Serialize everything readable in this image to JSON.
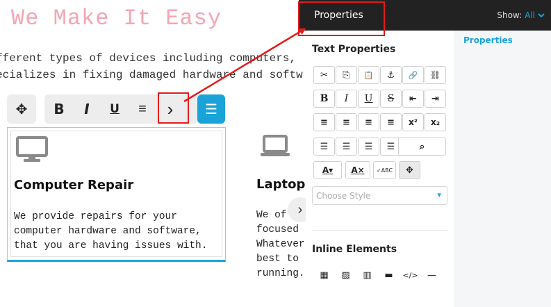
{
  "canvas": {
    "hero_title": "We Make It Easy",
    "intro_lines": [
      "fferent types of devices including computers,",
      "ecializes in fixing damaged hardware and softw"
    ],
    "card1": {
      "title": "Computer Repair",
      "text_lines": [
        "We provide repairs for your",
        "computer hardware and software,",
        "that you are having issues with."
      ]
    },
    "card2": {
      "title": "Laptop R",
      "text_lines": [
        "We of",
        "focused",
        "Whatever",
        "best to",
        "running."
      ]
    },
    "toolbar_glyphs": {
      "move": "✥",
      "bold": "B",
      "italic": "I",
      "underline": "U",
      "align": "≡",
      "more": "›",
      "menu": "☰"
    }
  },
  "panel": {
    "tab_label": "Properties",
    "show_label": "Show:",
    "show_value": "All",
    "side_link": "Properties",
    "text_properties_title": "Text Properties",
    "inline_elements_title": "Inline Elements",
    "style_select": {
      "placeholder": "Choose Style",
      "value": ""
    },
    "rows": {
      "r1": [
        "✂",
        "⎘",
        "📋",
        "⚓",
        "🔗",
        "⛓"
      ],
      "r2": [
        "B",
        "I",
        "U",
        "S",
        "⇤",
        "⇥"
      ],
      "r3": [
        "≡",
        "≡",
        "≡",
        "≡",
        "x²",
        "x₂"
      ],
      "r4": [
        "☰",
        "☰",
        "☰",
        "☰",
        "⌕"
      ],
      "r5": [
        "A▾",
        "A×",
        "✓ABC",
        "✥"
      ]
    },
    "inline_glyphs": [
      "▦",
      "▨",
      "▥",
      "▬",
      "</>",
      "—"
    ]
  },
  "colors": {
    "accent": "#1aa3d9",
    "hero_pink": "#f4a5b4",
    "topbar": "#222222",
    "annotation_red": "#e31b1b"
  }
}
